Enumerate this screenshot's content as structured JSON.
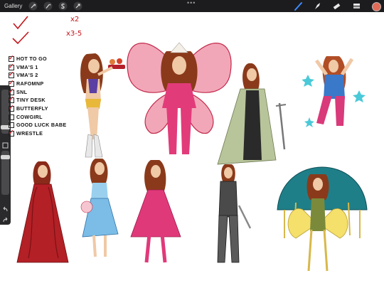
{
  "toolbar": {
    "gallery_label": "Gallery",
    "icons": [
      "wrench-icon",
      "magic-wand-icon",
      "selection-s-icon",
      "transform-arrow-icon",
      "more-dots-icon",
      "brush-icon",
      "smudge-icon",
      "eraser-icon",
      "layers-icon"
    ],
    "active_color": "#e06b57",
    "more_label": "•••"
  },
  "checklist": {
    "items": [
      {
        "label": "HOT TO GO",
        "checked": true
      },
      {
        "label": "VMA'S 1",
        "checked": true
      },
      {
        "label": "VMA'S 2",
        "checked": true
      },
      {
        "label": "RAFOMNP",
        "checked": true
      },
      {
        "label": "SNL",
        "checked": true
      },
      {
        "label": "TINY DESK",
        "checked": true
      },
      {
        "label": "BUTTERFLY",
        "checked": true
      },
      {
        "label": "COWGIRL",
        "checked": false
      },
      {
        "label": "GOOD LUCK BABE",
        "checked": false
      },
      {
        "label": "WRESTLE",
        "checked": true
      }
    ]
  },
  "notes": {
    "x2": "x2",
    "x35": "x3-5"
  },
  "sidebar": {
    "icons": [
      "brush-size-slider",
      "modify-square-icon",
      "opacity-slider",
      "undo-icon",
      "redo-icon"
    ]
  }
}
